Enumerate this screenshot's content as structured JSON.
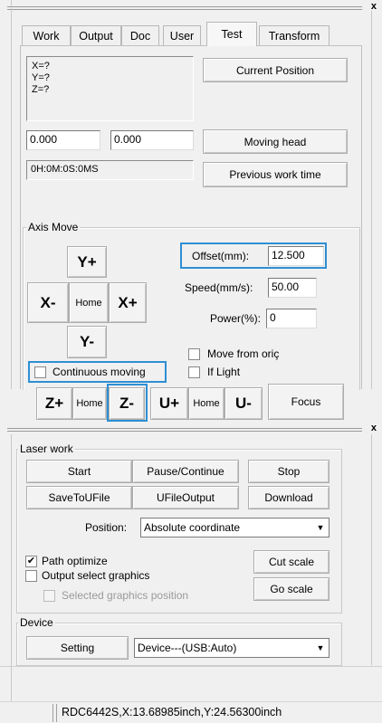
{
  "tabs": [
    "Work",
    "Output",
    "Doc",
    "User",
    "Test",
    "Transform"
  ],
  "close_glyph": "x",
  "position_readout": [
    "X=?",
    "Y=?",
    "Z=?"
  ],
  "current_position_button": "Current Position",
  "moving_head": {
    "field1": "0.000",
    "field2": "0.000",
    "button": "Moving head"
  },
  "work_time": {
    "value": "0H:0M:0S:0MS",
    "button": "Previous work time"
  },
  "axis_move": {
    "legend": "Axis Move",
    "y_plus": "Y+",
    "y_minus": "Y-",
    "x_minus": "X-",
    "x_plus": "X+",
    "home": "Home",
    "offset_label": "Offset(mm):",
    "offset_value": "12.500",
    "speed_label": "Speed(mm/s):",
    "speed_value": "50.00",
    "power_label": "Power(%):",
    "power_value": "0",
    "move_from_origin": "Move from oriç",
    "if_light": "If Light",
    "continuous_moving": "Continuous moving",
    "z_plus": "Z+",
    "z_minus": "Z-",
    "u_plus": "U+",
    "u_minus": "U-",
    "focus": "Focus"
  },
  "laser_work": {
    "legend": "Laser work",
    "start": "Start",
    "pause_continue": "Pause/Continue",
    "stop": "Stop",
    "save_to_ufile": "SaveToUFile",
    "ufile_output": "UFileOutput",
    "download": "Download",
    "position_label": "Position:",
    "position_value": "Absolute coordinate",
    "path_optimize": "Path optimize",
    "path_optimize_checked": true,
    "output_select_graphics": "Output select graphics",
    "selected_graphics_position": "Selected graphics position",
    "cut_scale": "Cut scale",
    "go_scale": "Go scale"
  },
  "device": {
    "legend": "Device",
    "setting": "Setting",
    "device_value": "Device---(USB:Auto)"
  },
  "status_bar": "RDC6442S,X:13.68985inch,Y:24.56300inch",
  "accent_color": "#2e8fd4"
}
